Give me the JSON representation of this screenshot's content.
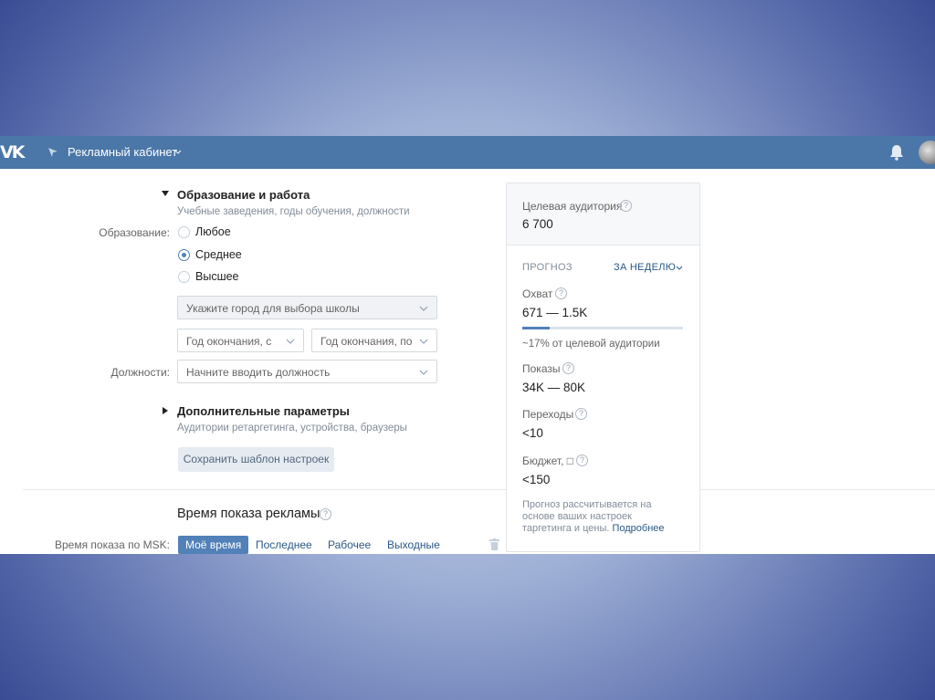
{
  "topbar": {
    "logo_text": "VK",
    "title": "Рекламный кабинет"
  },
  "education": {
    "section_title": "Образование и работа",
    "section_subtitle": "Учебные заведения, годы обучения, должности",
    "field_label": "Образование:",
    "options": [
      {
        "label": "Любое",
        "selected": false
      },
      {
        "label": "Среднее",
        "selected": true
      },
      {
        "label": "Высшее",
        "selected": false
      }
    ],
    "school_city_placeholder": "Укажите город для выбора школы",
    "grad_from_placeholder": "Год окончания, с",
    "grad_to_placeholder": "Год окончания, по",
    "position_label": "Должности:",
    "position_placeholder": "Начните вводить должность"
  },
  "extra": {
    "section_title": "Дополнительные параметры",
    "section_subtitle": "Аудитории ретаргетинга, устройства, браузеры"
  },
  "save_template_label": "Сохранить шаблон настроек",
  "ad_time": {
    "section_title": "Время показа рекламы",
    "row_label": "Время показа по MSK:",
    "tabs": [
      {
        "label": "Моё время",
        "active": true
      },
      {
        "label": "Последнее",
        "active": false
      },
      {
        "label": "Рабочее",
        "active": false
      },
      {
        "label": "Выходные",
        "active": false
      }
    ]
  },
  "forecast_panel": {
    "target_audience_label": "Целевая аудитория",
    "target_audience_value": "6 700",
    "forecast_label": "ПРОГНОЗ",
    "period_label": "ЗА НЕДЕЛЮ",
    "reach_label": "Охват",
    "reach_value": "671 — 1.5K",
    "reach_progress_percent": 17,
    "reach_note": "~17% от целевой аудитории",
    "impressions_label": "Показы",
    "impressions_value": "34K — 80K",
    "clicks_label": "Переходы",
    "clicks_value": "<10",
    "budget_label": "Бюджет, □",
    "budget_value": "<150",
    "note_text": "Прогноз рассчитывается на основе ваших настроек таргетинга и цены.",
    "note_link": "Подробнее"
  },
  "colors": {
    "topbar": "#4a76a8",
    "accent": "#5181b8",
    "link": "#2a5885"
  }
}
